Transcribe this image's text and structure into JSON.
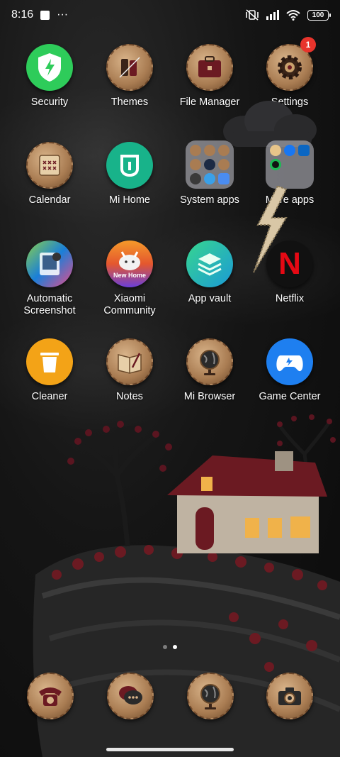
{
  "status_bar": {
    "time": "8:16",
    "more": "···",
    "battery": "100"
  },
  "apps": {
    "security": "Security",
    "themes": "Themes",
    "file_manager": "File Manager",
    "settings": "Settings",
    "settings_badge": "1",
    "calendar": "Calendar",
    "mi_home": "Mi Home",
    "system_apps": "System apps",
    "more_apps": "More apps",
    "automatic_screenshot": "Automatic Screenshot",
    "xiaomi_community": "Xiaomi Community",
    "xiaomi_community_badge": "New Home",
    "app_vault": "App vault",
    "netflix": "Netflix",
    "netflix_logo": "N",
    "cleaner": "Cleaner",
    "notes": "Notes",
    "mi_browser": "Mi Browser",
    "game_center": "Game Center"
  },
  "pager": {
    "pages": 2,
    "current": 2
  },
  "colors": {
    "security_green": "#2ecc5a",
    "mi_home_teal": "#18b38a",
    "netflix_red": "#e50914",
    "cleaner_orange": "#f3a317",
    "game_center_blue": "#1e7ff0",
    "settings_badge_red": "#e8342c"
  }
}
